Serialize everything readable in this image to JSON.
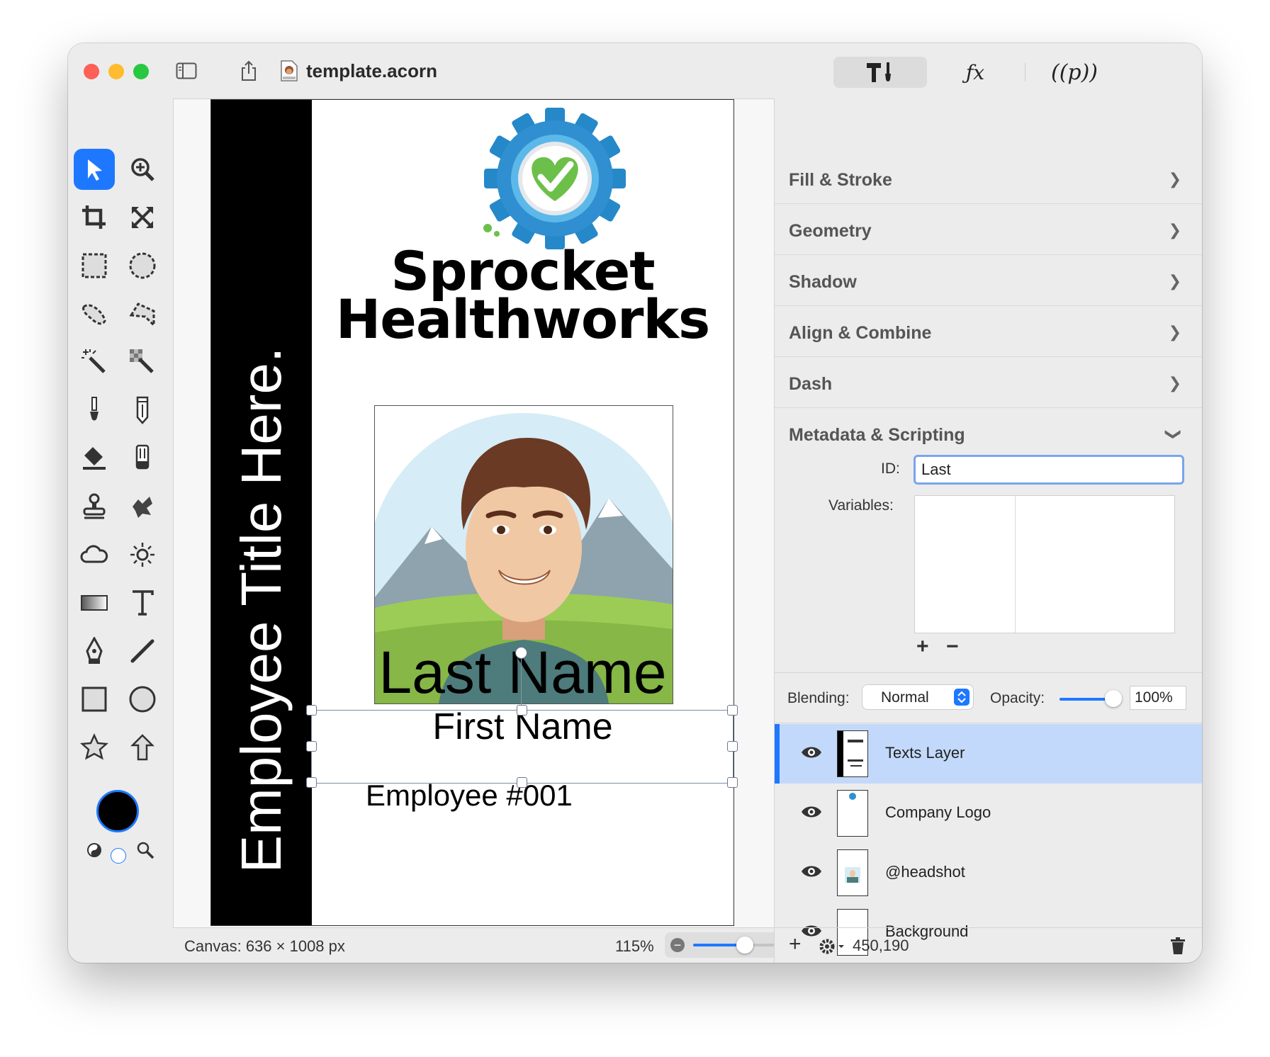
{
  "window": {
    "title": "template.acorn"
  },
  "toolbar": {
    "tools_seg": "tools",
    "fx_seg": "fx",
    "p_seg": "(p)"
  },
  "card": {
    "employee_title": "Employee Title Here.",
    "company_line1": "Sprocket",
    "company_line2": "Healthworks",
    "last_name": "Last Name",
    "first_name": "First Name",
    "employee_number": "Employee #001"
  },
  "status_bar": {
    "canvas_size": "Canvas: 636 × 1008 px",
    "zoom": "115%",
    "zoom_level": 0.55
  },
  "inspector": {
    "sections": [
      {
        "label": "Fill & Stroke",
        "expanded": false
      },
      {
        "label": "Geometry",
        "expanded": false
      },
      {
        "label": "Shadow",
        "expanded": false
      },
      {
        "label": "Align & Combine",
        "expanded": false
      },
      {
        "label": "Dash",
        "expanded": false
      },
      {
        "label": "Metadata & Scripting",
        "expanded": true
      }
    ],
    "id_label": "ID:",
    "id_value": "Last",
    "variables_label": "Variables:",
    "add_symbol": "+",
    "remove_symbol": "−",
    "blending_label": "Blending:",
    "blending_value": "Normal",
    "opacity_label": "Opacity:",
    "opacity_value": "100%",
    "opacity_level": 1.0
  },
  "layers": [
    {
      "name": "Texts Layer",
      "selected": true
    },
    {
      "name": "Company Logo",
      "selected": false
    },
    {
      "name": "@headshot",
      "selected": false
    },
    {
      "name": "Background",
      "selected": false
    }
  ],
  "layers_bar": {
    "add_symbol": "+",
    "coordinates": "450,190"
  },
  "colors": {
    "accent": "#1e78ff",
    "selected_layer": "#c3d9fb",
    "close": "#fe5f57",
    "minimize": "#febc2e",
    "zoom": "#28c840"
  }
}
